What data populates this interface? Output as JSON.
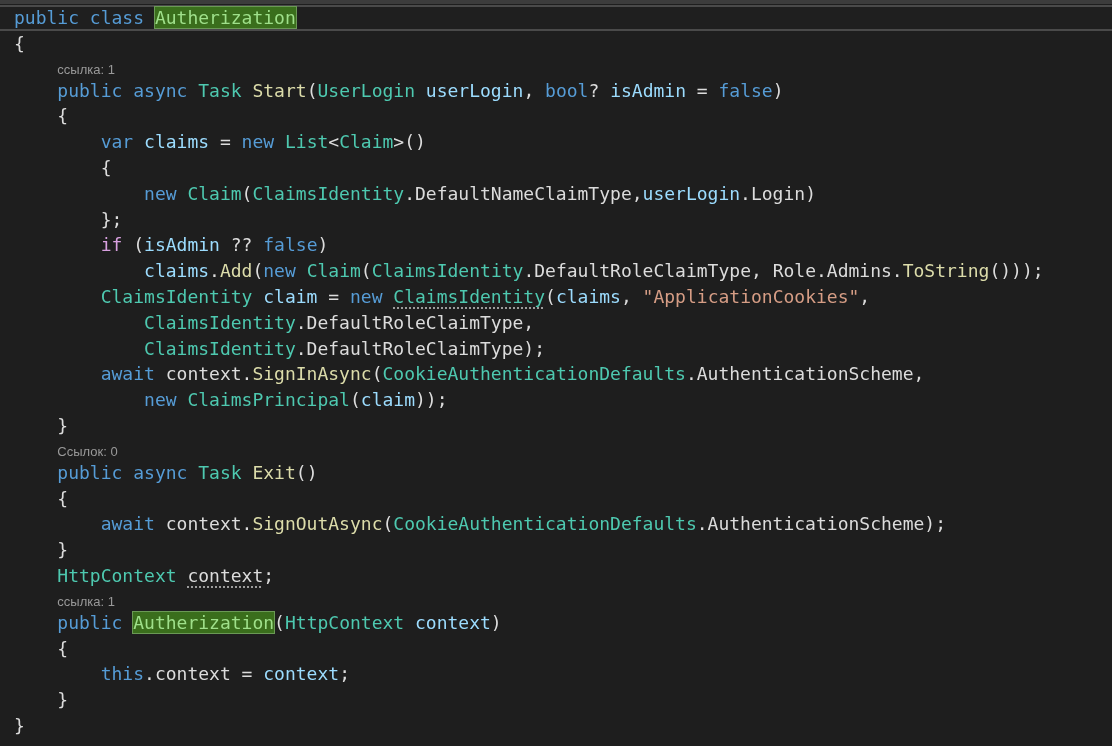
{
  "editor": {
    "lines": [
      {
        "current": true,
        "tokens": [
          {
            "text": "public ",
            "kind": "keyword"
          },
          {
            "text": "class ",
            "kind": "keyword"
          },
          {
            "text": "Autherization",
            "kind": "highlight"
          }
        ]
      },
      {
        "current": false,
        "tokens": [
          {
            "text": "{",
            "kind": "plain"
          }
        ]
      },
      {
        "current": false,
        "lens": "ссылка: 1",
        "tokens": [
          {
            "text": "    public ",
            "kind": "keyword"
          },
          {
            "text": "async ",
            "kind": "keyword"
          },
          {
            "text": "Task ",
            "kind": "type"
          },
          {
            "text": "Start",
            "kind": "method"
          },
          {
            "text": "(",
            "kind": "plain"
          },
          {
            "text": "UserLogin ",
            "kind": "type"
          },
          {
            "text": "userLogin",
            "kind": "variable"
          },
          {
            "text": ", ",
            "kind": "plain"
          },
          {
            "text": "bool",
            "kind": "keyword"
          },
          {
            "text": "? ",
            "kind": "plain"
          },
          {
            "text": "isAdmin ",
            "kind": "variable"
          },
          {
            "text": "= ",
            "kind": "plain"
          },
          {
            "text": "false",
            "kind": "keyword"
          },
          {
            "text": ")",
            "kind": "plain"
          }
        ]
      },
      {
        "current": false,
        "tokens": [
          {
            "text": "    {",
            "kind": "plain"
          }
        ]
      },
      {
        "current": false,
        "tokens": [
          {
            "text": "        var ",
            "kind": "keyword"
          },
          {
            "text": "claims ",
            "kind": "variable"
          },
          {
            "text": "= ",
            "kind": "plain"
          },
          {
            "text": "new ",
            "kind": "keyword"
          },
          {
            "text": "List",
            "kind": "type"
          },
          {
            "text": "<",
            "kind": "plain"
          },
          {
            "text": "Claim",
            "kind": "type"
          },
          {
            "text": ">()",
            "kind": "plain"
          }
        ]
      },
      {
        "current": false,
        "tokens": [
          {
            "text": "        {",
            "kind": "plain"
          }
        ]
      },
      {
        "current": false,
        "tokens": [
          {
            "text": "            new ",
            "kind": "keyword"
          },
          {
            "text": "Claim",
            "kind": "type"
          },
          {
            "text": "(",
            "kind": "plain"
          },
          {
            "text": "ClaimsIdentity",
            "kind": "type"
          },
          {
            "text": ".DefaultNameClaimType,",
            "kind": "plain"
          },
          {
            "text": "userLogin",
            "kind": "variable"
          },
          {
            "text": ".Login)",
            "kind": "plain"
          }
        ]
      },
      {
        "current": false,
        "tokens": [
          {
            "text": "        };",
            "kind": "plain"
          }
        ]
      },
      {
        "current": false,
        "tokens": [
          {
            "text": "        if ",
            "kind": "control"
          },
          {
            "text": "(",
            "kind": "plain"
          },
          {
            "text": "isAdmin ",
            "kind": "variable"
          },
          {
            "text": "?? ",
            "kind": "plain"
          },
          {
            "text": "false",
            "kind": "keyword"
          },
          {
            "text": ")",
            "kind": "plain"
          }
        ]
      },
      {
        "current": false,
        "tokens": [
          {
            "text": "            claims",
            "kind": "variable"
          },
          {
            "text": ".",
            "kind": "plain"
          },
          {
            "text": "Add",
            "kind": "method"
          },
          {
            "text": "(",
            "kind": "plain"
          },
          {
            "text": "new ",
            "kind": "keyword"
          },
          {
            "text": "Claim",
            "kind": "type"
          },
          {
            "text": "(",
            "kind": "plain"
          },
          {
            "text": "ClaimsIdentity",
            "kind": "type"
          },
          {
            "text": ".DefaultRoleClaimType, Role.Admins.",
            "kind": "plain"
          },
          {
            "text": "ToString",
            "kind": "method"
          },
          {
            "text": "()));",
            "kind": "plain"
          }
        ]
      },
      {
        "current": false,
        "tokens": [
          {
            "text": "        ClaimsIdentity ",
            "kind": "type"
          },
          {
            "text": "claim ",
            "kind": "variable"
          },
          {
            "text": "= ",
            "kind": "plain"
          },
          {
            "text": "new ",
            "kind": "keyword"
          },
          {
            "text": "ClaimsIdentity",
            "kind": "type",
            "hint": true
          },
          {
            "text": "(",
            "kind": "plain"
          },
          {
            "text": "claims",
            "kind": "variable"
          },
          {
            "text": ", ",
            "kind": "plain"
          },
          {
            "text": "\"ApplicationCookies\"",
            "kind": "string"
          },
          {
            "text": ",",
            "kind": "plain"
          }
        ]
      },
      {
        "current": false,
        "tokens": [
          {
            "text": "            ClaimsIdentity",
            "kind": "type"
          },
          {
            "text": ".DefaultRoleClaimType,",
            "kind": "plain"
          }
        ]
      },
      {
        "current": false,
        "tokens": [
          {
            "text": "            ClaimsIdentity",
            "kind": "type"
          },
          {
            "text": ".DefaultRoleClaimType);",
            "kind": "plain"
          }
        ]
      },
      {
        "current": false,
        "tokens": [
          {
            "text": "        await ",
            "kind": "keyword"
          },
          {
            "text": "context.",
            "kind": "plain"
          },
          {
            "text": "SignInAsync",
            "kind": "method"
          },
          {
            "text": "(",
            "kind": "plain"
          },
          {
            "text": "CookieAuthenticationDefaults",
            "kind": "type"
          },
          {
            "text": ".AuthenticationScheme,",
            "kind": "plain"
          }
        ]
      },
      {
        "current": false,
        "tokens": [
          {
            "text": "            new ",
            "kind": "keyword"
          },
          {
            "text": "ClaimsPrincipal",
            "kind": "type"
          },
          {
            "text": "(",
            "kind": "plain"
          },
          {
            "text": "claim",
            "kind": "variable"
          },
          {
            "text": "));",
            "kind": "plain"
          }
        ]
      },
      {
        "current": false,
        "tokens": [
          {
            "text": "    }",
            "kind": "plain"
          }
        ]
      },
      {
        "current": false,
        "lens": "Ссылок: 0",
        "tokens": [
          {
            "text": "    public ",
            "kind": "keyword"
          },
          {
            "text": "async ",
            "kind": "keyword"
          },
          {
            "text": "Task ",
            "kind": "type"
          },
          {
            "text": "Exit",
            "kind": "method"
          },
          {
            "text": "()",
            "kind": "plain"
          }
        ]
      },
      {
        "current": false,
        "tokens": [
          {
            "text": "    {",
            "kind": "plain"
          }
        ]
      },
      {
        "current": false,
        "tokens": [
          {
            "text": "        await ",
            "kind": "keyword"
          },
          {
            "text": "context.",
            "kind": "plain"
          },
          {
            "text": "SignOutAsync",
            "kind": "method"
          },
          {
            "text": "(",
            "kind": "plain"
          },
          {
            "text": "CookieAuthenticationDefaults",
            "kind": "type"
          },
          {
            "text": ".AuthenticationScheme);",
            "kind": "plain"
          }
        ]
      },
      {
        "current": false,
        "tokens": [
          {
            "text": "    }",
            "kind": "plain"
          }
        ]
      },
      {
        "current": false,
        "tokens": [
          {
            "text": "    HttpContext ",
            "kind": "type"
          },
          {
            "text": "context",
            "kind": "plain",
            "hint": true
          },
          {
            "text": ";",
            "kind": "plain"
          }
        ]
      },
      {
        "current": false,
        "lens": "ссылка: 1",
        "tokens": [
          {
            "text": "    public ",
            "kind": "keyword"
          },
          {
            "text": "Autherization",
            "kind": "highlight"
          },
          {
            "text": "(",
            "kind": "plain"
          },
          {
            "text": "HttpContext ",
            "kind": "type"
          },
          {
            "text": "context",
            "kind": "variable"
          },
          {
            "text": ")",
            "kind": "plain"
          }
        ]
      },
      {
        "current": false,
        "tokens": [
          {
            "text": "    {",
            "kind": "plain"
          }
        ]
      },
      {
        "current": false,
        "tokens": [
          {
            "text": "        this",
            "kind": "keyword"
          },
          {
            "text": ".context = ",
            "kind": "plain"
          },
          {
            "text": "context",
            "kind": "variable"
          },
          {
            "text": ";",
            "kind": "plain"
          }
        ]
      },
      {
        "current": false,
        "tokens": [
          {
            "text": "    }",
            "kind": "plain"
          }
        ]
      },
      {
        "current": false,
        "tokens": [
          {
            "text": "}",
            "kind": "plain"
          }
        ]
      }
    ]
  }
}
